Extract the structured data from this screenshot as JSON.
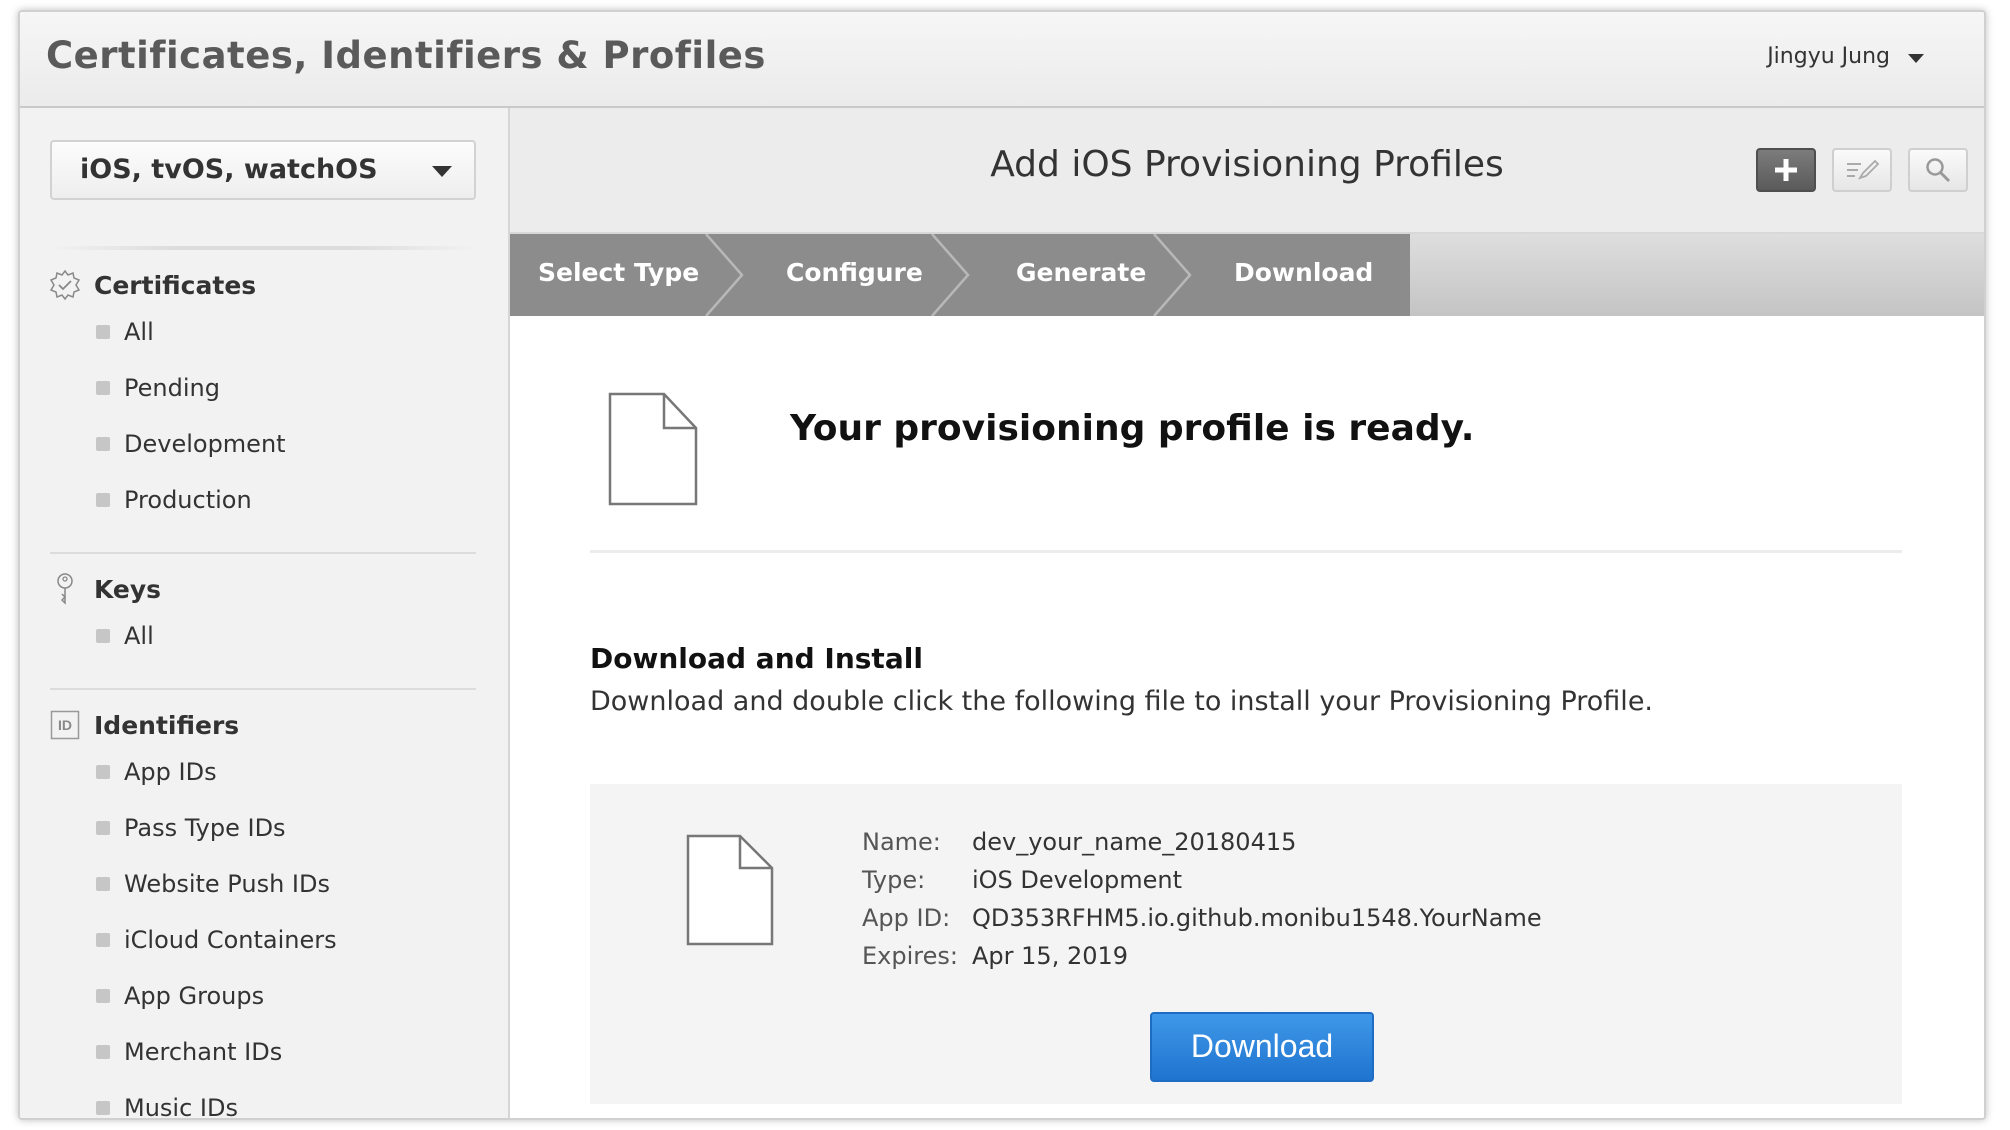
{
  "header": {
    "app_title": "Certificates, Identifiers & Profiles",
    "user_name": "Jingyu Jung"
  },
  "sidebar": {
    "platform": "iOS, tvOS, watchOS",
    "sections": [
      {
        "title": "Certificates",
        "icon": "certificate-badge-icon",
        "items": [
          "All",
          "Pending",
          "Development",
          "Production"
        ]
      },
      {
        "title": "Keys",
        "icon": "key-icon",
        "items": [
          "All"
        ]
      },
      {
        "title": "Identifiers",
        "icon": "id-icon",
        "icon_text": "ID",
        "items": [
          "App IDs",
          "Pass Type IDs",
          "Website Push IDs",
          "iCloud Containers",
          "App Groups",
          "Merchant IDs",
          "Music IDs"
        ]
      }
    ]
  },
  "main": {
    "title": "Add iOS Provisioning Profiles",
    "toolbar": [
      "add-icon",
      "edit-icon",
      "search-icon"
    ],
    "steps": [
      "Select Type",
      "Configure",
      "Generate",
      "Download"
    ],
    "ready_message": "Your provisioning profile is ready.",
    "download_section": {
      "heading": "Download and Install",
      "description": "Download and double click the following file to install your Provisioning Profile."
    },
    "profile": {
      "name_label": "Name:",
      "name": "dev_your_name_20180415",
      "type_label": "Type:",
      "type": "iOS Development",
      "app_id_label": "App ID:",
      "app_id": "QD353RFHM5.io.github.monibu1548.YourName",
      "expires_label": "Expires:",
      "expires": "Apr 15, 2019"
    },
    "download_button": "Download"
  },
  "colors": {
    "primary_button": "#1f74cf",
    "step_active": "#8c8c8c",
    "sidebar_bg": "#f2f2f2"
  }
}
